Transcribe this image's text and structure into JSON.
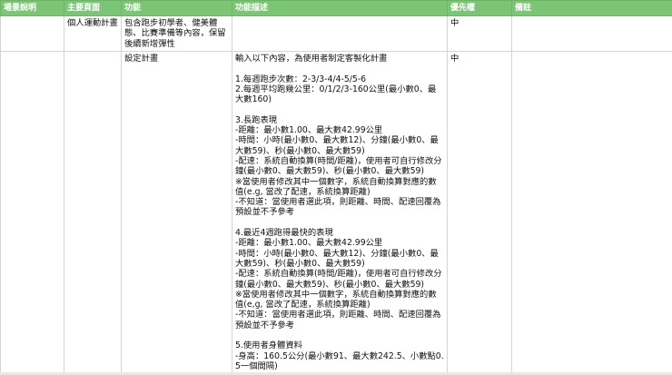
{
  "headers": [
    "場景說明",
    "主要頁面",
    "功能",
    "功能描述",
    "優先權",
    "備註"
  ],
  "rows": [
    {
      "scene": "",
      "page": "個人運動計畫",
      "feature": "包含跑步初學者、健美體態、比賽準備等內容，保留後續新增彈性",
      "description": "",
      "priority": "中",
      "note": ""
    },
    {
      "scene": "",
      "page": "",
      "feature": "設定計畫",
      "description": "輸入以下內容，為使用者制定客製化計畫\n\n1.每週跑步次數：2-3/3-4/4-5/5-6\n2.每週平均跑幾公里：0/1/2/3-160公里(最小數0、最大數160)\n\n3.長跑表現\n-距離：最小數1.00、最大數42.99公里\n-時間：小時(最小數0、最大數12)、分鐘(最小數0、最大數59)、秒(最小數0、最大數59)\n-配速：系統自動換算(時間/距離)，使用者可自行修改分鐘(最小數0、最大數59)、秒(最小數0、最大數59)\n※當使用者修改其中一個數字，系統自動換算對應的數值(e.g, 當改了配速，系統換算距離)\n-不知道：當使用者選此項，則距離、時間、配速回覆為預設並不予參考\n\n4.最近4週跑得最快的表現\n-距離：最小數1.00、最大數42.99公里\n-時間：小時(最小數0、最大數12)、分鐘(最小數0、最大數59)、秒(最小數0、最大數59)\n-配速：系統自動換算(時間/距離)，使用者可自行修改分鐘(最小數0、最大數59)、秒(最小數0、最大數59)\n※當使用者修改其中一個數字，系統自動換算對應的數值(e,g, 當改了配速，系統換算距離)\n-不知道：當使用者選此項，則距離、時間、配速回覆為預設並不予參考\n\n5.使用者身體資料\n-身高：160.5公分(最小數91、最大數242.5、小數點0.5一個間隔)",
      "priority": "中",
      "note": ""
    }
  ]
}
